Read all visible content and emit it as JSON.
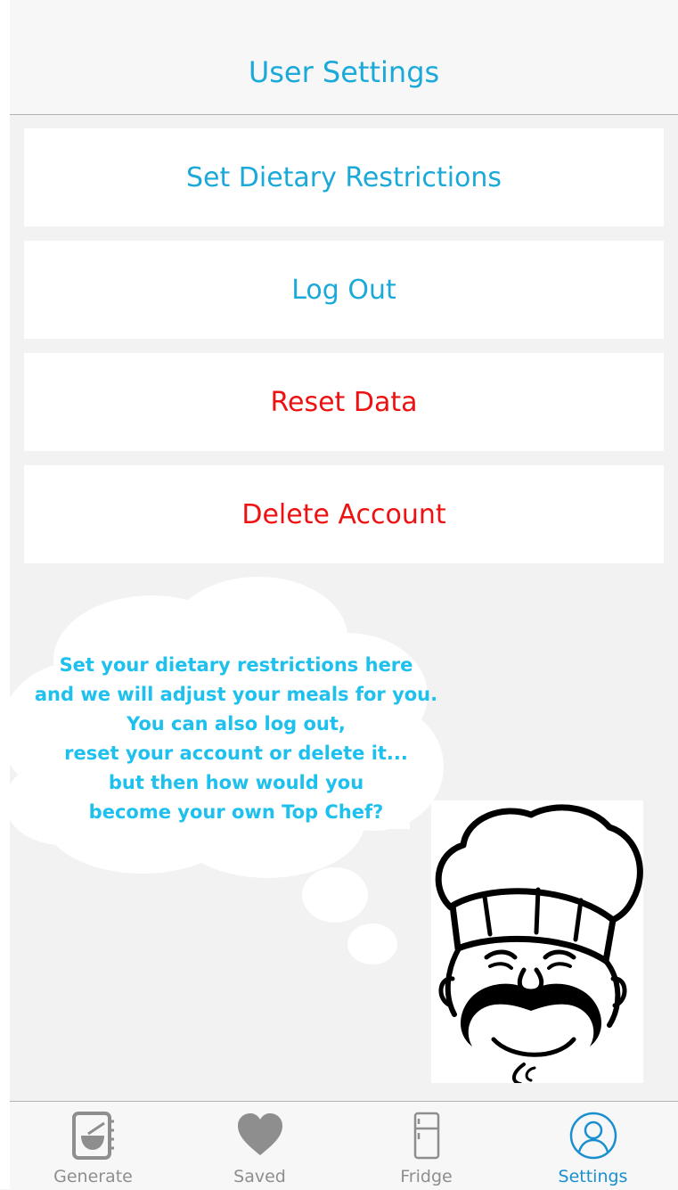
{
  "header": {
    "title": "User Settings"
  },
  "settings": {
    "buttons": [
      {
        "label": "Set Dietary Restrictions",
        "color": "#1aa9d8"
      },
      {
        "label": "Log Out",
        "color": "#1aa9d8"
      },
      {
        "label": "Reset Data",
        "color": "#ee1111"
      },
      {
        "label": "Delete Account",
        "color": "#ee1111"
      }
    ]
  },
  "bubble": {
    "lines": [
      "Set your dietary restrictions here",
      "and we will adjust your meals for you.",
      "You can also log out,",
      "reset your account or delete it...",
      "but then how would you",
      "become your own Top Chef?"
    ],
    "text_color": "#1ec0ee"
  },
  "mascot": {
    "icon": "chef-mascot-icon"
  },
  "tabs": {
    "items": [
      {
        "label": "Generate",
        "icon": "cookbook-icon",
        "active": false
      },
      {
        "label": "Saved",
        "icon": "heart-icon",
        "active": false
      },
      {
        "label": "Fridge",
        "icon": "fridge-icon",
        "active": false
      },
      {
        "label": "Settings",
        "icon": "user-icon",
        "active": true
      }
    ],
    "active_color": "#1a8fd0",
    "inactive_color": "#8e8e8e"
  }
}
